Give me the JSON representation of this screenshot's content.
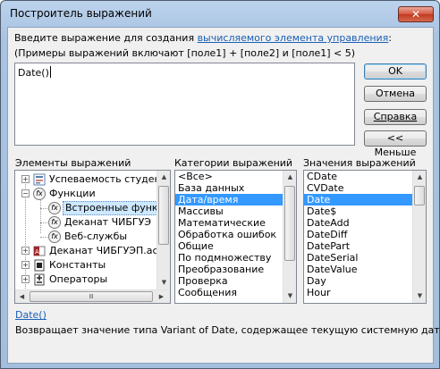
{
  "window": {
    "title": "Построитель выражений",
    "close_glyph": "✕"
  },
  "prompt": {
    "line1_prefix": "Введите выражение для создания ",
    "line1_link": "вычисляемого элемента управления",
    "line1_suffix": ":",
    "line2": "(Примеры выражений включают [поле1] + [поле2] и [поле1] < 5)"
  },
  "expression": {
    "value": "Date()"
  },
  "buttons": {
    "ok": "OK",
    "cancel": "Отмена",
    "help": "Справка",
    "less": "<< Меньше"
  },
  "panes": {
    "elements_label": "Элементы выражений",
    "categories_label": "Категории выражений",
    "values_label": "Значения выражений"
  },
  "tree": {
    "items": [
      {
        "label": "Успеваемость студен",
        "icon": "form-icon",
        "toggle": "+"
      },
      {
        "label": "Функции",
        "icon": "fx-icon",
        "toggle": "−"
      },
      {
        "label": "Встроенные функ",
        "icon": "fx-icon",
        "toggle": "",
        "selected": true
      },
      {
        "label": "Деканат ЧИБГУЭ",
        "icon": "fx-icon",
        "toggle": ""
      },
      {
        "label": "Веб-службы",
        "icon": "fx-icon",
        "toggle": ""
      },
      {
        "label": "Деканат ЧИБГУЭП.ac",
        "icon": "access-db-icon",
        "toggle": "+"
      },
      {
        "label": "Константы",
        "icon": "constants-icon",
        "toggle": "+"
      },
      {
        "label": "Операторы",
        "icon": "operators-icon",
        "toggle": "+"
      }
    ]
  },
  "categories": {
    "items": [
      "<Все>",
      "База данных",
      "Дата/время",
      "Массивы",
      "Математические",
      "Обработка ошибок",
      "Общие",
      "По подмножеству",
      "Преобразование",
      "Проверка",
      "Сообщения"
    ],
    "selected_index": 2
  },
  "values": {
    "items": [
      "CDate",
      "CVDate",
      "Date",
      "Date$",
      "DateAdd",
      "DateDiff",
      "DatePart",
      "DateSerial",
      "DateValue",
      "Day",
      "Hour"
    ],
    "selected_index": 2
  },
  "footer": {
    "function_link": "Date()",
    "description": "Возвращает значение типа Variant of Date, содержащее текущую системную дату."
  }
}
